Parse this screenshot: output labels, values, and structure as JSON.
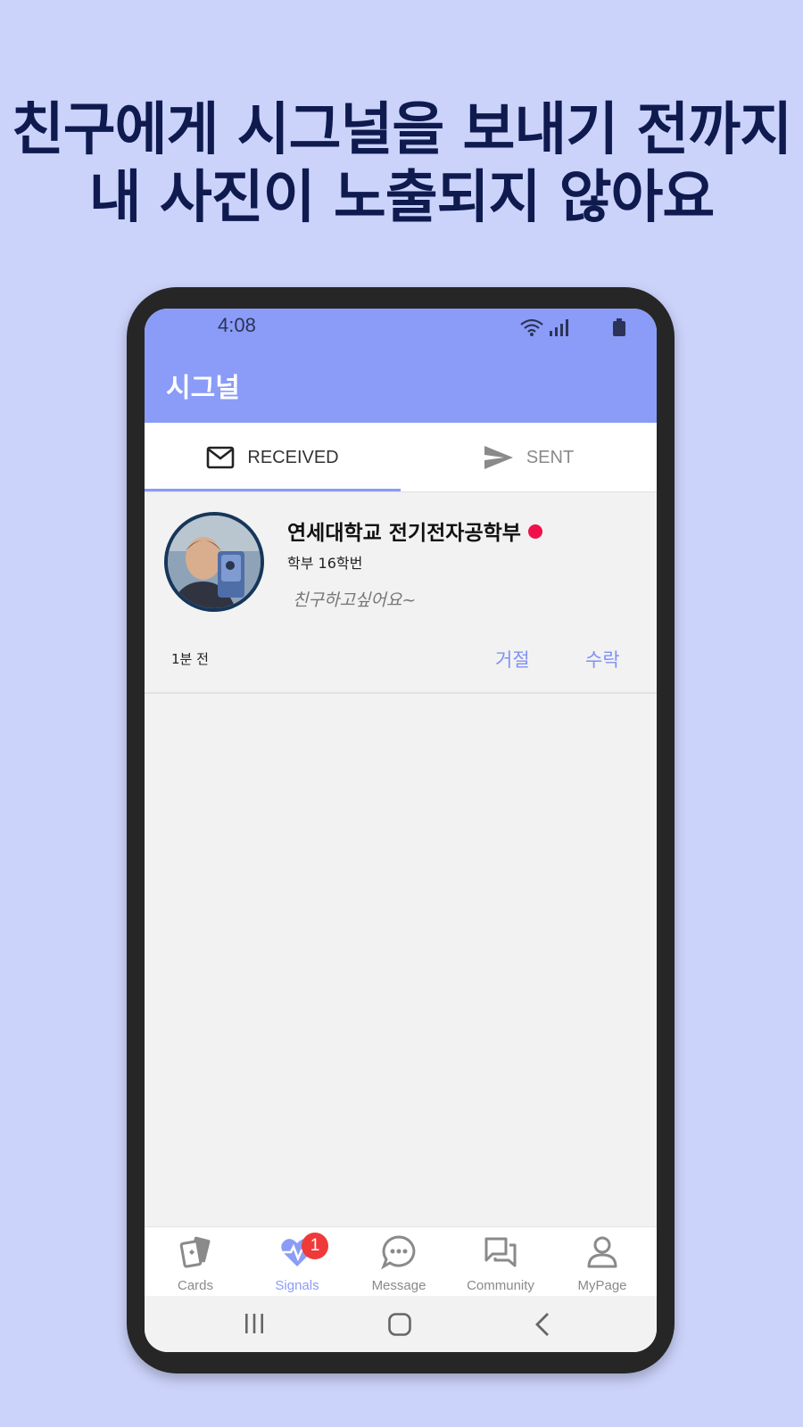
{
  "headline": {
    "line1": "친구에게 시그널을 보내기 전까지",
    "line2": "내 사진이 노출되지 않아요"
  },
  "status_bar": {
    "time": "4:08"
  },
  "app_bar": {
    "title": "시그널"
  },
  "tabs": [
    {
      "label": "RECEIVED",
      "icon": "mail-icon",
      "active": true
    },
    {
      "label": "SENT",
      "icon": "send-icon",
      "active": false
    }
  ],
  "signal_card": {
    "name": "연세대학교 전기전자공학부",
    "meta": "학부 16학번",
    "message": "친구하고싶어요~",
    "time_ago": "1분 전",
    "reject_label": "거절",
    "accept_label": "수락"
  },
  "bottom_nav": [
    {
      "label": "Cards",
      "icon": "cards-icon"
    },
    {
      "label": "Signals",
      "icon": "heart-pulse-icon",
      "active": true,
      "badge": "1"
    },
    {
      "label": "Message",
      "icon": "chat-bubble-icon"
    },
    {
      "label": "Community",
      "icon": "forum-icon"
    },
    {
      "label": "MyPage",
      "icon": "person-icon"
    }
  ],
  "colors": {
    "background": "#ccd3fb",
    "headline": "#0f1a4f",
    "accent": "#8a9cf7",
    "badge": "#f03939",
    "online_dot": "#f0114a"
  }
}
